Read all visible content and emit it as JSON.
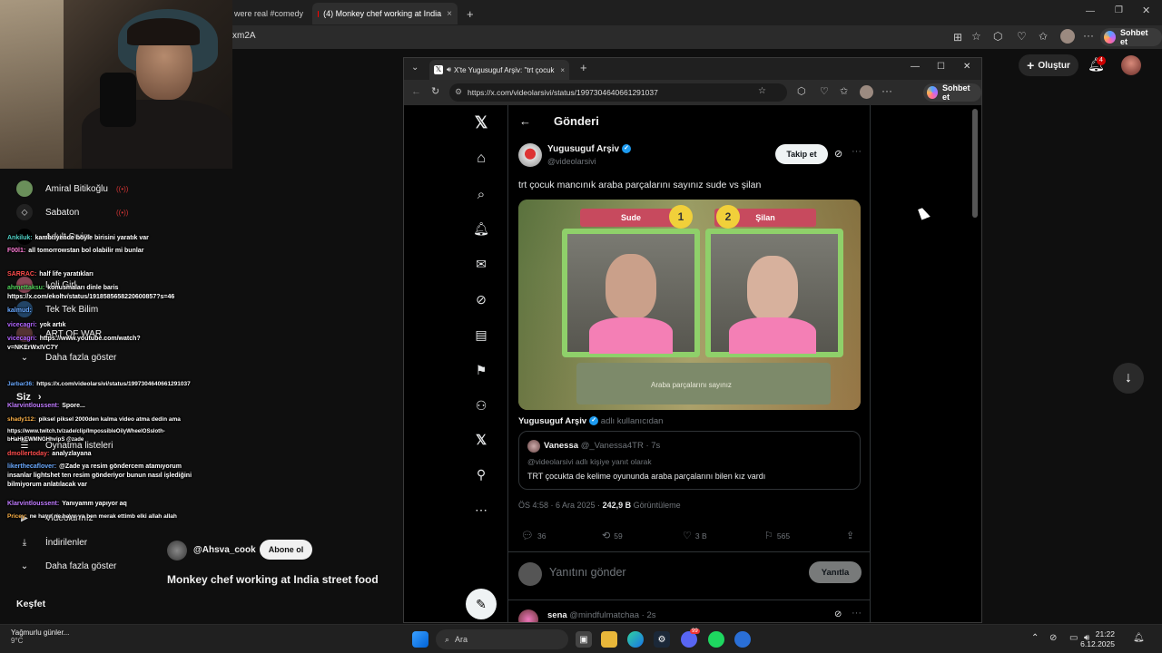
{
  "outer_browser": {
    "tabs": [
      {
        "label": "were real #comedy",
        "active": false
      },
      {
        "label": "(4) Monkey chef working at India",
        "active": true
      }
    ],
    "new_tab": "+",
    "url_fragment": "xm2A",
    "chat_button": "Sohbet et"
  },
  "youtube": {
    "create_button": "Oluştur",
    "notification_count": "4",
    "sidebar": [
      {
        "label": "Amiral Bitikoğlu"
      },
      {
        "label": "Sabaton"
      },
      {
        "label": "Adult Swim"
      },
      {
        "label": "Loli Girl"
      },
      {
        "label": "Tek Tek Bilim"
      },
      {
        "label": "ART OF WAR"
      },
      {
        "label": "Daha fazla göster"
      },
      {
        "label": "Siz"
      },
      {
        "label": "Oynatma listeleri"
      },
      {
        "label": "Videolarınız"
      },
      {
        "label": "İndirilenler"
      },
      {
        "label": "Daha fazla göster"
      },
      {
        "label": "Keşfet"
      }
    ],
    "channel_name": "@Ahsva_cook",
    "subscribe_button": "Abone ol",
    "video_title": "Monkey chef working at India street food"
  },
  "stream_chat": [
    {
      "user": "Ankiluk:",
      "msg": "kambriyende böyle birisini yaratık var",
      "color": "#4fd1c5"
    },
    {
      "user": "F00l1:",
      "msg": "all tomorrowstan bol olabilir mi bunlar",
      "color": "#ff7bd5"
    },
    {
      "user": "SARRAC:",
      "msg": "half life yaratıkları",
      "color": "#ff4d4d"
    },
    {
      "user": "ahmettaksu:",
      "msg": "konusmaları dinle baris",
      "color": "#4fd15a"
    },
    {
      "user": "",
      "msg": "https://x.com/ekoltv/status/1918585658220600857?s=46",
      "color": "#ffffff"
    },
    {
      "user": "kalmud:",
      "msg": "Tek Tek Bilim",
      "color": "#6aa9ff"
    },
    {
      "user": "vicecagri:",
      "msg": "yok artık",
      "color": "#b366ff"
    },
    {
      "user": "vicecagri:",
      "msg": "https://www.youtube.com/watch?",
      "color": "#b366ff"
    },
    {
      "user": "",
      "msg": "v=NKErWxIVC7Y",
      "color": "#ffffff"
    },
    {
      "user": "Jarbar36:",
      "msg": "https://x.com/videolarsivi/status/1997304640661291037",
      "color": "#6aa9ff"
    },
    {
      "user": "Klarvintloussent:",
      "msg": "Spore...",
      "color": "#c07bff"
    },
    {
      "user": "shady112:",
      "msg": "piksel piksel 2000den kalma video atma dedin ama",
      "color": "#ffb347"
    },
    {
      "user": "",
      "msg": "https://www.twitch.tv/zade/clip/ImpossibleOilyWheelOSsloth-bHaHkEWMNGHhvipS @zade",
      "color": "#ffffff"
    },
    {
      "user": "dmollertoday:",
      "msg": "analyzlayana",
      "color": "#ff4d4d"
    },
    {
      "user": "likerthecaflover:",
      "msg": "@Zade ya resim göndercem atamıyorum insanlar lightshet ten resim gönderiyor bunun nasıl işlediğini bilmiyorum anlatılacak var",
      "color": "#6aa9ff"
    },
    {
      "user": "Klarvintloussent:",
      "msg": "Yanıyamm yapıyor aq",
      "color": "#c07bff"
    },
    {
      "user": "Pricey:",
      "msg": "ne hayır ne hayır ya ben merak ettimb elki allah allah",
      "color": "#ffb347"
    }
  ],
  "inner_browser": {
    "tab_title": "X'te Yugusuguf Arşiv: \"trt çocuk",
    "url": "https://x.com/videolarsivi/status/1997304640661291037",
    "chat_button": "Sohbet et"
  },
  "x_post": {
    "header_title": "Gönderi",
    "author_name": "Yugusuguf Arşiv",
    "author_handle": "@videolarsivi",
    "follow_button": "Takip et",
    "text": "trt çocuk mancınık araba parçalarını sayınız sude vs şilan",
    "media": {
      "left_name": "Sude",
      "right_name": "Şilan",
      "left_number": "1",
      "right_number": "2",
      "caption": "Araba parçalarını sayınız"
    },
    "reply_context_name": "Yugusuguf Arşiv",
    "reply_context_suffix": "adlı kullanıcıdan",
    "quote": {
      "name": "Vanessa",
      "handle": "@_Vanessa4TR · 7s",
      "replying": "@videolarsivi adlı kişiye yanıt olarak",
      "text": "TRT çocukta de kelime oyununda araba parçalarını bilen kız vardı"
    },
    "meta_time": "ÖS 4:58 · 6 Ara 2025 · ",
    "meta_views": "242,9 B",
    "meta_views_label": " Görüntüleme",
    "actions": {
      "replies": "36",
      "reposts": "59",
      "likes": "3 B",
      "bookmarks": "565"
    },
    "reply_placeholder": "Yanıtını gönder",
    "reply_button": "Yanıtla",
    "next_reply_name": "sena",
    "next_reply_handle": "@mindfulmatchaa · 2s"
  },
  "taskbar": {
    "weather_text": "Yağmurlu günler...",
    "weather_temp": "9°C",
    "search_placeholder": "Ara",
    "time": "21:22",
    "date": "6.12.2025",
    "discord_badge": "99"
  },
  "colors": {
    "x_blue": "#1d9bf0",
    "yt_red": "#cc0000",
    "background": "#0f0f0f"
  }
}
